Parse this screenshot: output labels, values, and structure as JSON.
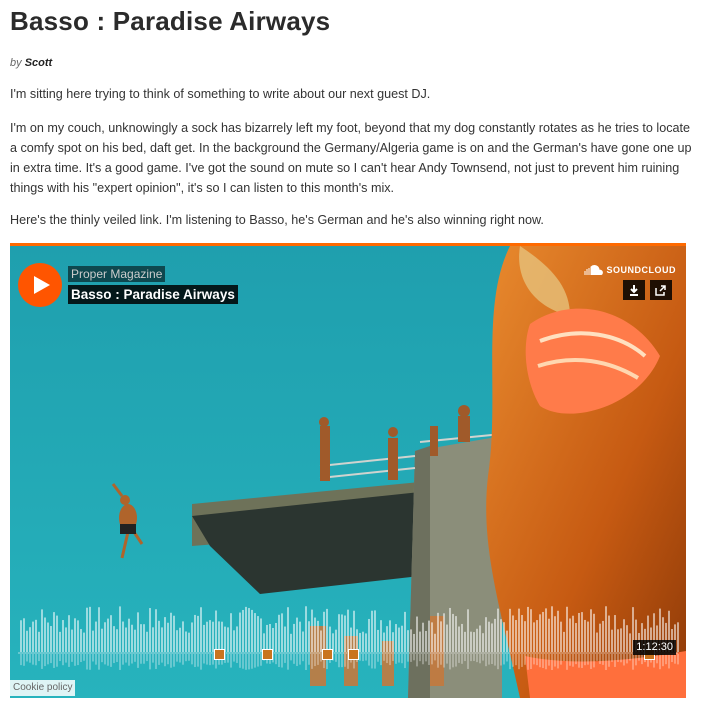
{
  "article": {
    "title": "Basso : Paradise Airways",
    "byline_prefix": "by",
    "author": "Scott",
    "paragraphs": [
      "I'm sitting here trying to think of something to write about our next guest DJ.",
      "I'm on my couch, unknowingly a sock has bizarrely left my foot, beyond that my dog constantly rotates as he tries to locate a comfy spot on his bed, daft get. In the background the Germany/Algeria game is on and the German's have gone one up in extra time. It's a good game. I've got the sound on mute so I can't hear Andy Townsend, not just to prevent him ruining things with his \"expert opinion\", it's so I can listen to this month's mix.",
      "Here's the thinly veiled link. I'm listening to Basso, he's German and he's also winning right now."
    ]
  },
  "player": {
    "artist": "Proper Magazine",
    "track": "Basso : Paradise Airways",
    "brand": "SOUNDCLOUD",
    "duration": "1:12:30",
    "cookie_link": "Cookie policy",
    "accent": "#ff5500",
    "icons": {
      "play": "play-icon",
      "download": "download-icon",
      "share": "share-icon",
      "logo": "soundcloud-logo-icon"
    }
  }
}
